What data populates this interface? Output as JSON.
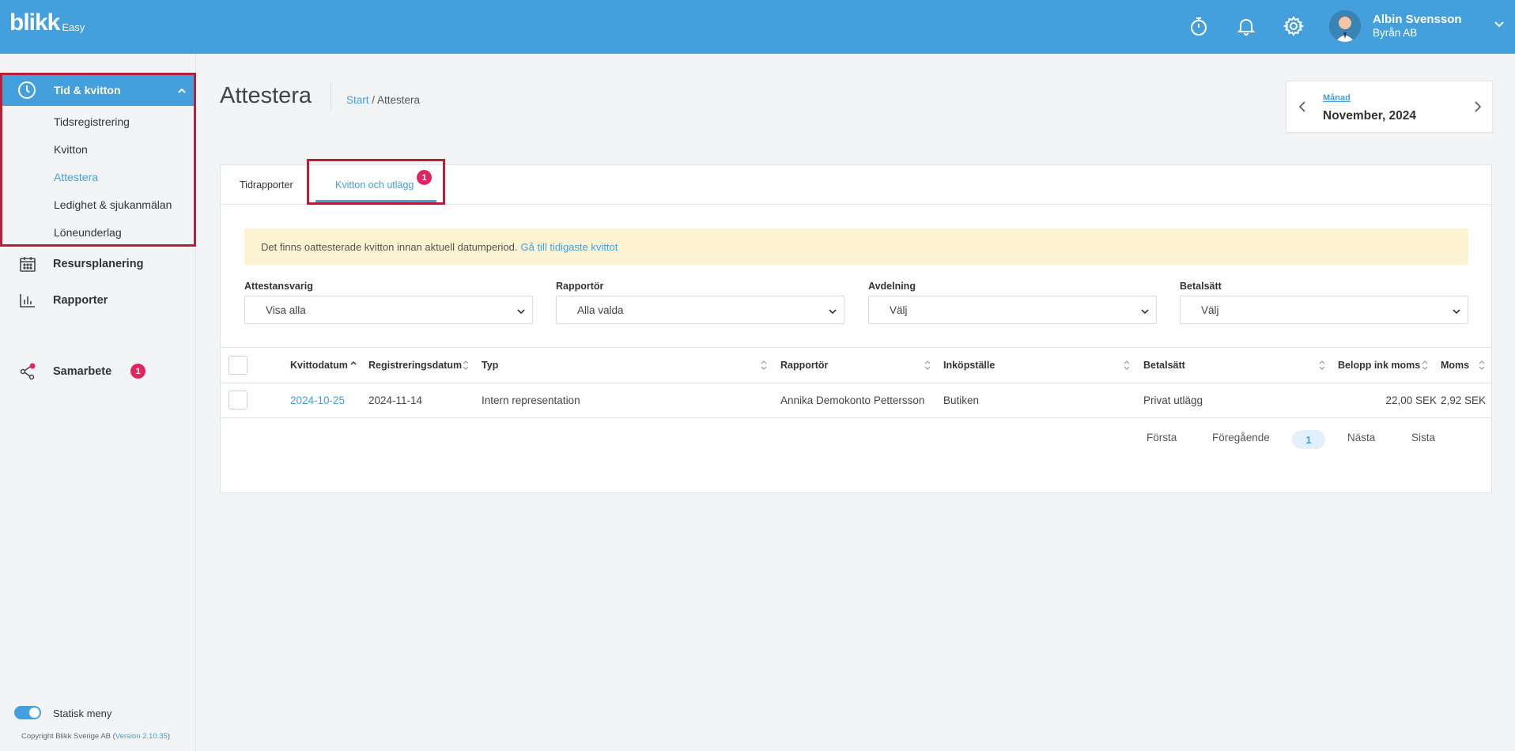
{
  "header": {
    "logo_text": "blikk",
    "logo_sub": "Easy",
    "user_name": "Albin Svensson",
    "company": "Byrån AB",
    "icons": [
      "stopwatch-icon",
      "bell-icon",
      "gear-icon",
      "chevron-down-icon"
    ]
  },
  "sidebar": {
    "section": {
      "label": "Tid & kvitton",
      "items": [
        {
          "label": "Tidsregistrering"
        },
        {
          "label": "Kvitton"
        },
        {
          "label": "Attestera",
          "active": true
        },
        {
          "label": "Ledighet & sjukanmälan"
        },
        {
          "label": "Löneunderlag"
        }
      ]
    },
    "items": [
      {
        "label": "Resursplanering"
      },
      {
        "label": "Rapporter"
      },
      {
        "label": "Samarbete",
        "badge": "1"
      }
    ],
    "toggle_label": "Statisk meny",
    "copyright": "Copyright Blikk Sverige AB (",
    "version": "Version 2.10.35",
    "copyright_end": ")"
  },
  "page": {
    "title": "Attestera",
    "breadcrumb_start": "Start",
    "breadcrumb_sep": " / ",
    "breadcrumb_current": "Attestera",
    "period_label": "Månad",
    "period_value": "November, 2024"
  },
  "tabs": [
    {
      "label": "Tidrapporter"
    },
    {
      "label": "Kvitton och utlägg",
      "badge": "1",
      "active": true
    }
  ],
  "notice": {
    "text": "Det finns oattesterade kvitton innan aktuell datumperiod.",
    "link": "Gå till tidigaste kvittot"
  },
  "filters": [
    {
      "label": "Attestansvarig",
      "value": "Visa alla"
    },
    {
      "label": "Rapportör",
      "value": "Alla valda"
    },
    {
      "label": "Avdelning",
      "value": "Välj"
    },
    {
      "label": "Betalsätt",
      "value": "Välj"
    }
  ],
  "table": {
    "columns": [
      "Kvittodatum",
      "Registreringsdatum",
      "Typ",
      "Rapportör",
      "Inköpställe",
      "Betalsätt",
      "Belopp ink moms",
      "Moms"
    ],
    "rows": [
      {
        "kvittodatum": "2024-10-25",
        "registreringsdatum": "2024-11-14",
        "typ": "Intern representation",
        "rapportor": "Annika Demokonto Pettersson",
        "inkopstalle": "Butiken",
        "betalsatt": "Privat utlägg",
        "belopp": "22,00 SEK",
        "moms": "2,92 SEK"
      }
    ]
  },
  "pagination": {
    "first": "Första",
    "prev": "Föregående",
    "current": "1",
    "next": "Nästa",
    "last": "Sista"
  },
  "colors": {
    "accent": "#43a0dc",
    "badge": "#e0245e",
    "highlight": "#b5203a",
    "notice_bg": "#fdf3d0"
  }
}
